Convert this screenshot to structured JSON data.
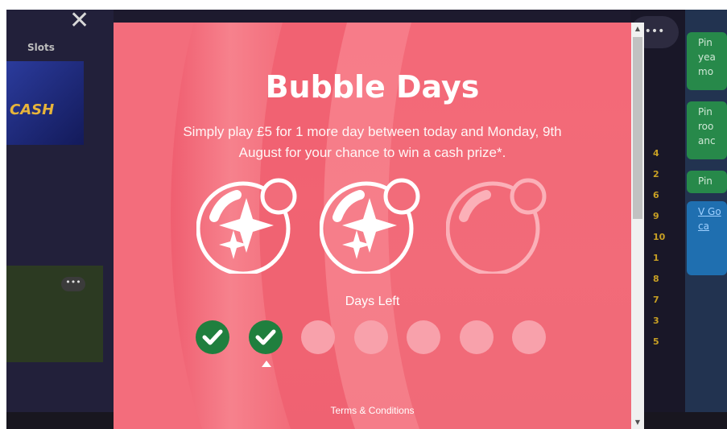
{
  "background": {
    "close_glyph": "✕",
    "slots_label": "Slots",
    "game_label": "CASH",
    "more_dots": "•••",
    "numbers": [
      "4",
      "2",
      "6",
      "9",
      "10",
      "1",
      "8",
      "7",
      "3",
      "5"
    ],
    "cards": [
      "Pin yea mo",
      "Pin roo anc",
      "Pin"
    ],
    "link_card": "V Go ca"
  },
  "modal": {
    "title": "Bubble Days",
    "subtitle_line1": "Simply play £5 for 1 more day between today and Monday, 9th",
    "subtitle_line2": "August for your chance to win a cash prize*.",
    "bubbles": [
      {
        "state": "earned",
        "icon": "sparkle-bubble-icon"
      },
      {
        "state": "earned",
        "icon": "sparkle-bubble-icon"
      },
      {
        "state": "empty",
        "icon": "empty-bubble-icon"
      }
    ],
    "days_left_label": "Days Left",
    "days": [
      {
        "done": true
      },
      {
        "done": true
      },
      {
        "done": false
      },
      {
        "done": false
      },
      {
        "done": false
      },
      {
        "done": false
      },
      {
        "done": false
      }
    ],
    "current_day_index": 1,
    "terms_label": "Terms & Conditions"
  },
  "colors": {
    "modal_bg": "#f26c7a",
    "check_green": "#1f7f3e",
    "pending_dot": "#f8a1ab"
  }
}
